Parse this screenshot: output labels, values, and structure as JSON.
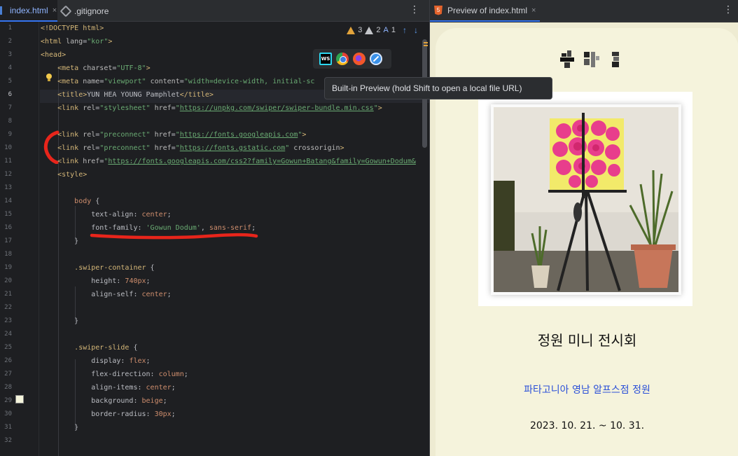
{
  "editor": {
    "tabs": [
      {
        "label": "index.html",
        "close": "×"
      },
      {
        "label": ".gitignore"
      }
    ],
    "menu_icon": "⋮",
    "inspections": {
      "warnings": "3",
      "weak_warnings": "2",
      "typos": "1"
    },
    "line_numbers": [
      "1",
      "2",
      "3",
      "4",
      "5",
      "6",
      "7",
      "8",
      "9",
      "10",
      "11",
      "12",
      "13",
      "14",
      "15",
      "16",
      "17",
      "18",
      "19",
      "20",
      "21",
      "22",
      "23",
      "24",
      "25",
      "26",
      "27",
      "28",
      "29",
      "30",
      "31",
      "32"
    ],
    "current_line": "6",
    "browser_icons": [
      "webstorm-icon",
      "chrome-icon",
      "firefox-icon",
      "safari-icon"
    ],
    "tooltip": "Built-in Preview (hold Shift to open a local file URL)",
    "swatch_color": "#f5f5dc",
    "markup_color": "#e8251b",
    "code": {
      "l1": "<!DOCTYPE html>",
      "l2_open": "<html ",
      "l2_attr": "lang",
      "l2_eq": "=",
      "l2_val": "\"kor\"",
      "l2_close": ">",
      "l3": "<head>",
      "l4_tag": "<meta ",
      "l4_attr": "charset",
      "l4_val": "\"UTF-8\"",
      "l4_close": ">",
      "l5_tag": "<meta ",
      "l5_attr1": "name",
      "l5_val1": "\"viewport\"",
      "l5_attr2": " content",
      "l5_val2": "\"width=device-width, initial-sc",
      "l6_tag": "<title>",
      "l6_text": "YUN HEA YOUNG Pamphlet",
      "l6_close": "</title>",
      "l7_tag": "<link ",
      "l7_attr1": "rel",
      "l7_val1": "\"stylesheet\"",
      "l7_attr2": " href",
      "l7_url": "https://unpkg.com/swiper/swiper-bundle.min.css",
      "l7_close": ">",
      "l9_tag": "<link ",
      "l9_attr1": "rel",
      "l9_val1": "\"preconnect\"",
      "l9_attr2": " href",
      "l9_url": "https://fonts.googleapis.com",
      "l9_close": ">",
      "l10_tag": "<link ",
      "l10_attr1": "rel",
      "l10_val1": "\"preconnect\"",
      "l10_attr2": " href",
      "l10_url": "https://fonts.gstatic.com",
      "l10_attr3": " crossorigin",
      "l10_close": ">",
      "l11_tag": "<link ",
      "l11_attr": "href",
      "l11_url": "https://fonts.googleapis.com/css2?family=Gowun+Batang&family=Gowun+Dodum&",
      "l12": "<style>",
      "l14_sel": "body",
      "l14_brace": " {",
      "l15_prop": "text-align",
      "l15_val": "center",
      "l16_prop": "font-family",
      "l16_val1": "'Gowun Dodum'",
      "l16_val2": "sans-serif",
      "l17": "}",
      "l19_sel": ".swiper-container",
      "l19_brace": " {",
      "l20_prop": "height",
      "l20_val": "740px",
      "l21_prop": "align-self",
      "l21_val": "center",
      "l23": "}",
      "l25_sel": ".swiper-slide",
      "l25_brace": " {",
      "l26_prop": "display",
      "l26_val": "flex",
      "l27_prop": "flex-direction",
      "l27_val": "column",
      "l28_prop": "align-items",
      "l28_val": "center",
      "l29_prop": "background",
      "l29_val": "beige",
      "l30_prop": "border-radius",
      "l30_val": "30px",
      "l31": "}"
    }
  },
  "preview": {
    "tab_label": "Preview of index.html",
    "tab_close": "×",
    "menu_icon": "⋮",
    "html5_badge": "5",
    "background": "#f5f3dc",
    "title": "정원 미니 전시회",
    "link": "파타고니아 영남 알프스점 정원",
    "date": "2023. 10. 21. ~ 10. 31."
  }
}
